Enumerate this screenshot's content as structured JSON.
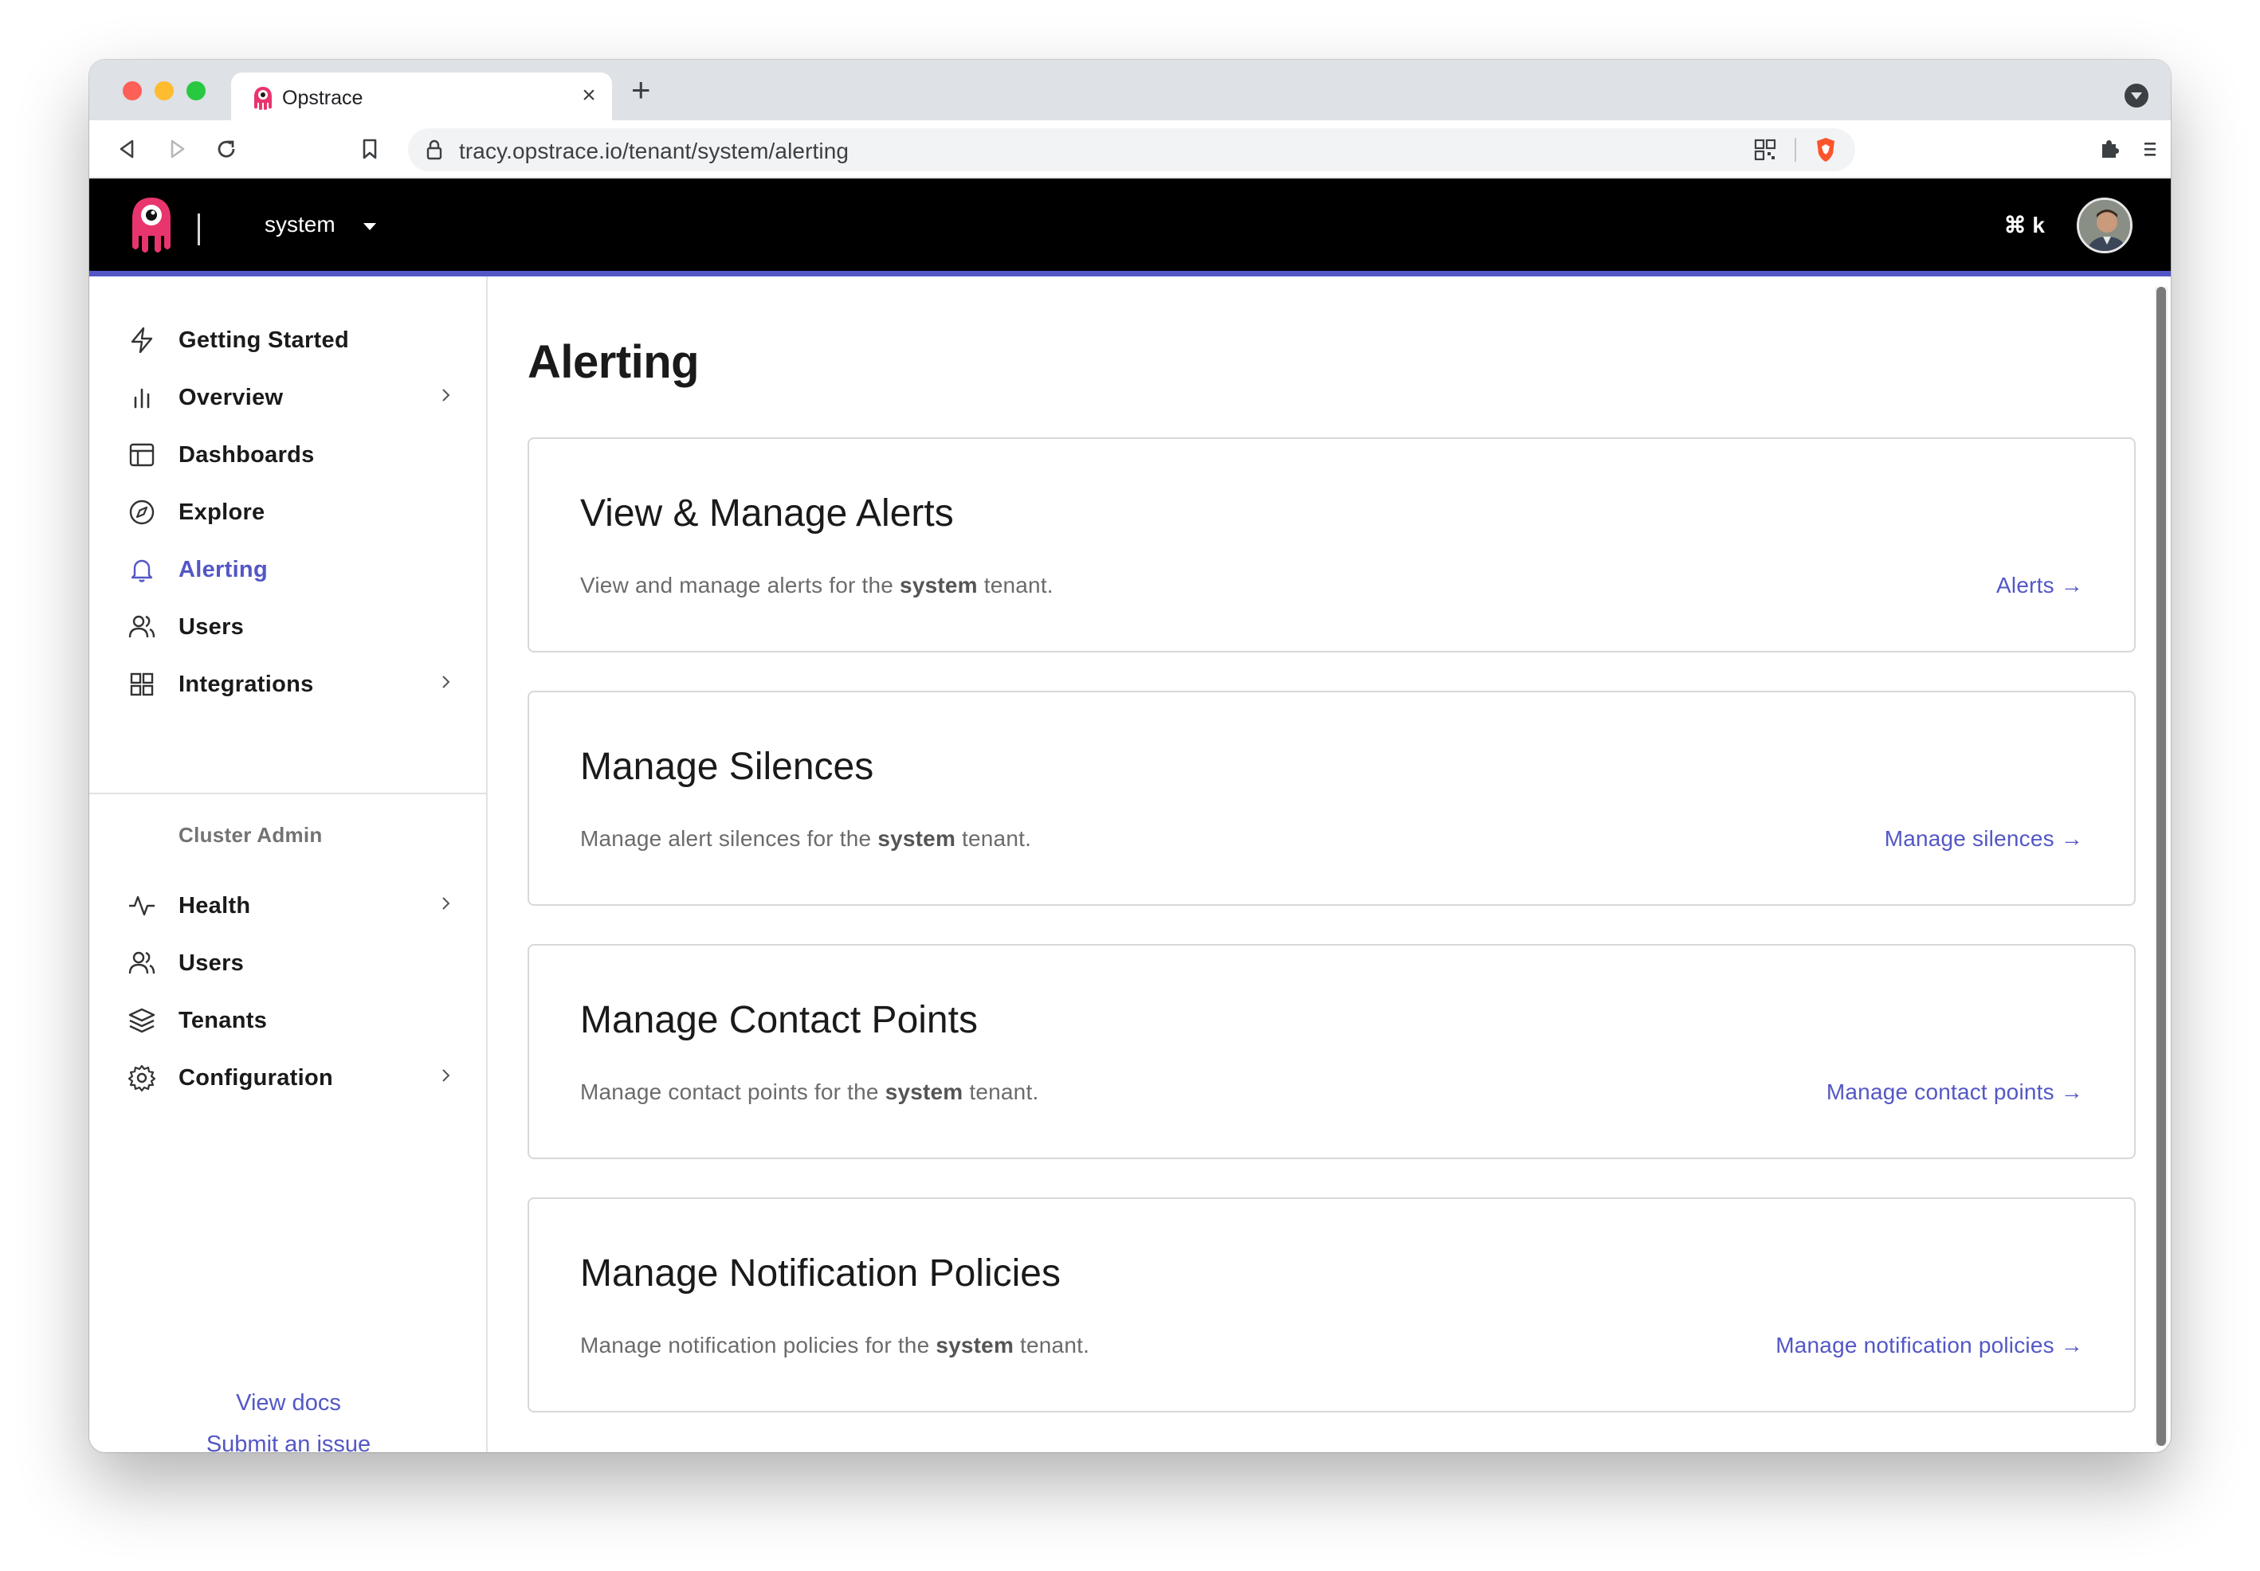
{
  "browser": {
    "tab_title": "Opstrace",
    "tab_close": "×",
    "new_tab": "+",
    "url": "tracy.opstrace.io/tenant/system/alerting"
  },
  "header": {
    "tenant": "system",
    "shortcut": "⌘ k"
  },
  "sidebar": {
    "items": [
      {
        "label": "Getting Started",
        "icon": "zap-icon"
      },
      {
        "label": "Overview",
        "icon": "bar-chart-icon",
        "chevron": true
      },
      {
        "label": "Dashboards",
        "icon": "layout-icon"
      },
      {
        "label": "Explore",
        "icon": "compass-icon"
      },
      {
        "label": "Alerting",
        "icon": "bell-icon",
        "active": true
      },
      {
        "label": "Users",
        "icon": "users-icon"
      },
      {
        "label": "Integrations",
        "icon": "grid-icon",
        "chevron": true
      }
    ],
    "section_title": "Cluster Admin",
    "admin_items": [
      {
        "label": "Health",
        "icon": "activity-icon",
        "chevron": true
      },
      {
        "label": "Users",
        "icon": "users-icon"
      },
      {
        "label": "Tenants",
        "icon": "layers-icon"
      },
      {
        "label": "Configuration",
        "icon": "settings-icon",
        "chevron": true
      }
    ],
    "view_docs": "View docs",
    "submit_issue": "Submit an issue"
  },
  "main": {
    "title": "Alerting",
    "cards": [
      {
        "title": "View & Manage Alerts",
        "desc_pre": "View and manage alerts for the",
        "desc_bold": "system",
        "desc_post": "tenant.",
        "link": "Alerts →"
      },
      {
        "title": "Manage Silences",
        "desc_pre": "Manage alert silences for the",
        "desc_bold": "system",
        "desc_post": "tenant.",
        "link": "Manage silences →"
      },
      {
        "title": "Manage Contact Points",
        "desc_pre": "Manage contact points for the",
        "desc_bold": "system",
        "desc_post": "tenant.",
        "link": "Manage contact points →"
      },
      {
        "title": "Manage Notification Policies",
        "desc_pre": "Manage notification policies for the",
        "desc_bold": "system",
        "desc_post": "tenant.",
        "link": "Manage notification policies →"
      }
    ]
  },
  "colors": {
    "accent": "#5357c5",
    "brand_pink": "#e8356d",
    "header_bg": "#000000"
  }
}
